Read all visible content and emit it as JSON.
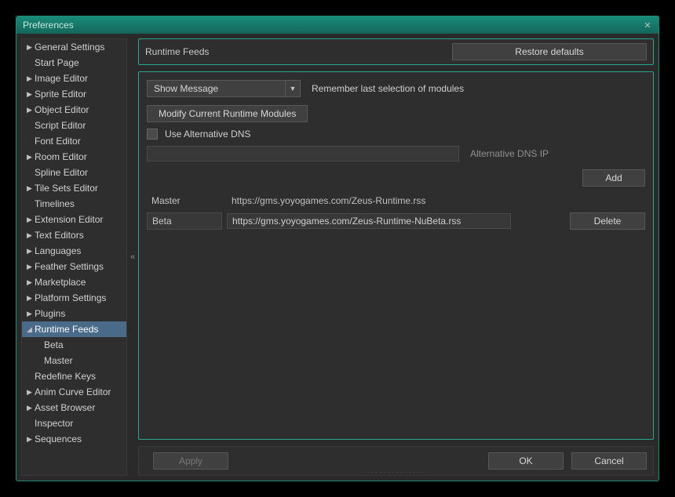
{
  "window": {
    "title": "Preferences"
  },
  "sidebar": {
    "items": [
      {
        "label": "General Settings",
        "expandable": true
      },
      {
        "label": "Start Page",
        "expandable": false
      },
      {
        "label": "Image Editor",
        "expandable": true
      },
      {
        "label": "Sprite Editor",
        "expandable": true
      },
      {
        "label": "Object Editor",
        "expandable": true
      },
      {
        "label": "Script Editor",
        "expandable": false
      },
      {
        "label": "Font Editor",
        "expandable": false
      },
      {
        "label": "Room Editor",
        "expandable": true
      },
      {
        "label": "Spline Editor",
        "expandable": false
      },
      {
        "label": "Tile Sets Editor",
        "expandable": true
      },
      {
        "label": "Timelines",
        "expandable": false
      },
      {
        "label": "Extension Editor",
        "expandable": true
      },
      {
        "label": "Text Editors",
        "expandable": true
      },
      {
        "label": "Languages",
        "expandable": true
      },
      {
        "label": "Feather Settings",
        "expandable": true
      },
      {
        "label": "Marketplace",
        "expandable": true
      },
      {
        "label": "Platform Settings",
        "expandable": true
      },
      {
        "label": "Plugins",
        "expandable": true
      },
      {
        "label": "Runtime Feeds",
        "expandable": true,
        "expanded": true,
        "selected": true,
        "children": [
          {
            "label": "Beta"
          },
          {
            "label": "Master"
          }
        ]
      },
      {
        "label": "Redefine Keys",
        "expandable": false
      },
      {
        "label": "Anim Curve Editor",
        "expandable": true
      },
      {
        "label": "Asset Browser",
        "expandable": true
      },
      {
        "label": "Inspector",
        "expandable": false
      },
      {
        "label": "Sequences",
        "expandable": true
      }
    ]
  },
  "collapse_glyph": "«",
  "panel": {
    "title": "Runtime Feeds",
    "restore_defaults": "Restore defaults",
    "dropdown_value": "Show Message",
    "remember_label": "Remember last selection of modules",
    "modify_button": "Modify Current Runtime Modules",
    "use_alt_dns_label": "Use Alternative DNS",
    "alt_dns_value": "",
    "alt_dns_caption": "Alternative DNS IP",
    "add_button": "Add",
    "feeds": [
      {
        "name": "Master",
        "url": "https://gms.yoyogames.com/Zeus-Runtime.rss",
        "editable": false
      },
      {
        "name": "Beta",
        "url": "https://gms.yoyogames.com/Zeus-Runtime-NuBeta.rss",
        "editable": true
      }
    ],
    "delete_button": "Delete"
  },
  "footer": {
    "apply": "Apply",
    "ok": "OK",
    "cancel": "Cancel"
  }
}
